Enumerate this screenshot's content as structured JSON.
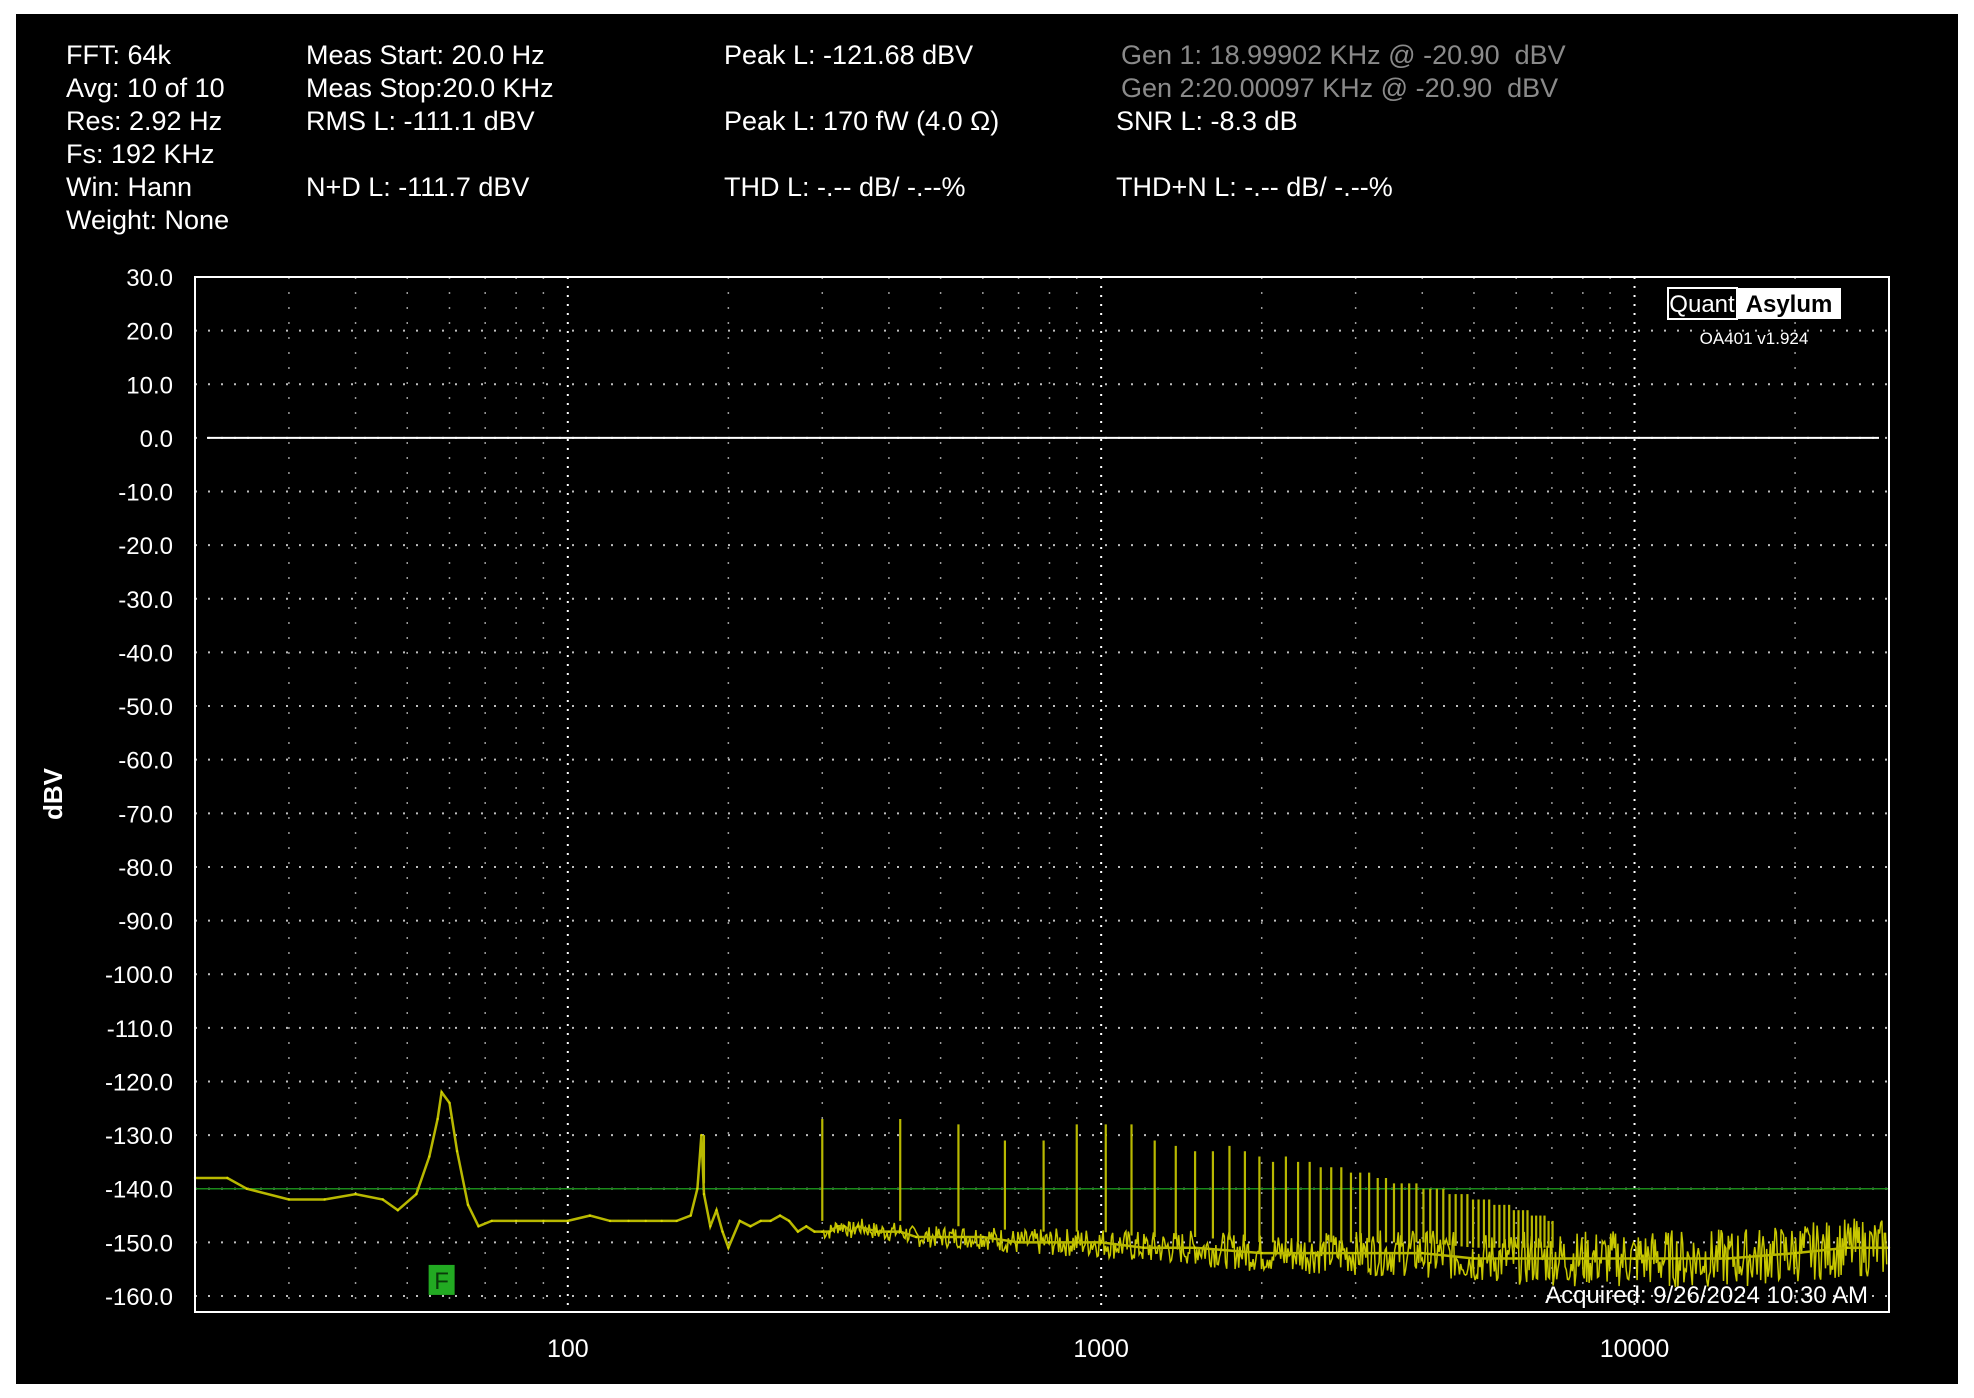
{
  "stats": {
    "fft": "FFT: 64k",
    "avg": "Avg: 10 of 10",
    "res": "Res: 2.92 Hz",
    "fs": "Fs: 192 KHz",
    "win": "Win: Hann",
    "weight": "Weight: None",
    "meas_start": "Meas Start: 20.0 Hz",
    "meas_stop": "Meas Stop:20.0 KHz",
    "rms": "RMS L: -111.1 dBV",
    "nd": "N+D L: -111.7 dBV",
    "peak_dbv": "Peak L: -121.68 dBV",
    "peak_power": "Peak L: 170 fW (4.0 Ω)",
    "thd": "THD L: -.-- dB/ -.--%",
    "gen1": "Gen 1: 18.99902 KHz @ -20.90  dBV",
    "gen2": "Gen 2:20.00097 KHz @ -20.90  dBV",
    "snr": "SNR L: -8.3 dB",
    "thdn": "THD+N L: -.-- dB/ -.--%"
  },
  "logo": {
    "left": "Quant",
    "right": "Asylum",
    "version": "OA401 v1.924"
  },
  "marker": {
    "label": "F",
    "x_hz": 58,
    "y_dbv": -157
  },
  "acquired": "Acquired: 9/26/2024  10:30 AM",
  "colors": {
    "background": "#000000",
    "trace": "#ffff00",
    "reference": "#ffffff",
    "threshold": "#1a8a1a",
    "marker": "#22aa22"
  },
  "chart_data": {
    "type": "line",
    "ylabel": "dBV",
    "xlabel": "",
    "x_scale": "log",
    "xlim": [
      20,
      30000
    ],
    "ylim": [
      -160,
      30
    ],
    "y_ticks": [
      "30.0",
      "20.0",
      "10.0",
      "0.0",
      "-10.0",
      "-20.0",
      "-30.0",
      "-40.0",
      "-50.0",
      "-60.0",
      "-70.0",
      "-80.0",
      "-90.0",
      "-100.0",
      "-110.0",
      "-120.0",
      "-130.0",
      "-140.0",
      "-150.0",
      "-160.0"
    ],
    "x_ticks": [
      "100",
      "1000",
      "10000"
    ],
    "grid": true,
    "series": [
      {
        "x": [
          20,
          23,
          25,
          30,
          35,
          40,
          45,
          48,
          52,
          55,
          57,
          58,
          60,
          62,
          65,
          68,
          72,
          80,
          90,
          100,
          110,
          120,
          130,
          140,
          150,
          160,
          170,
          175,
          178,
          180,
          185,
          190,
          195,
          200,
          210,
          220,
          230,
          240,
          250,
          260,
          270,
          280,
          290,
          300,
          310,
          320,
          330,
          340,
          350,
          380,
          400,
          420,
          450,
          500,
          550,
          600,
          700,
          800,
          900,
          1000,
          1200,
          1500,
          2000,
          2500,
          3000,
          4000,
          5000,
          6000,
          8000,
          10000,
          12000,
          15000,
          20000,
          25000,
          30000
        ],
        "y": [
          -138,
          -138,
          -140,
          -142,
          -142,
          -141,
          -142,
          -144,
          -141,
          -134,
          -127,
          -122,
          -124,
          -133,
          -143,
          -147,
          -146,
          -146,
          -146,
          -146,
          -145,
          -146,
          -146,
          -146,
          -146,
          -146,
          -145,
          -140,
          -130,
          -141,
          -147,
          -144,
          -148,
          -151,
          -146,
          -147,
          -146,
          -146,
          -145,
          -146,
          -148,
          -147,
          -148,
          -148,
          -148,
          -147,
          -147,
          -148,
          -147,
          -148,
          -148,
          -148,
          -149,
          -149,
          -149,
          -149,
          -150,
          -150,
          -150,
          -150,
          -151,
          -151,
          -152,
          -152,
          -152,
          -152,
          -153,
          -153,
          -153,
          -153,
          -153,
          -153,
          -152,
          -151,
          -151
        ]
      },
      {
        "name": "",
        "type": "harmonics",
        "x": [
          180,
          300,
          420,
          540,
          660,
          780,
          900,
          1020,
          1140,
          1260,
          1380,
          1500,
          1620,
          1740,
          1860,
          1980,
          2100,
          2220,
          2340,
          2460,
          2580,
          2700,
          2820,
          2940,
          3060,
          3180,
          3300,
          3420,
          3540,
          3660,
          3780,
          3900,
          4020,
          4140,
          4260,
          4380,
          4500,
          4620,
          4740,
          4860,
          4980,
          5100,
          5220,
          5340,
          5460,
          5580,
          5700,
          5820,
          5940,
          6060,
          6180,
          6300,
          6420,
          6540,
          6660,
          6780,
          6900,
          7020
        ],
        "y": [
          -130,
          -127,
          -127,
          -128,
          -131,
          -131,
          -128,
          -128,
          -128,
          -131,
          -132,
          -133,
          -133,
          -132,
          -133,
          -134,
          -135,
          -134,
          -135,
          -135,
          -136,
          -136,
          -136,
          -137,
          -137,
          -137,
          -138,
          -138,
          -139,
          -139,
          -139,
          -139,
          -140,
          -140,
          -140,
          -140,
          -141,
          -141,
          -141,
          -141,
          -142,
          -142,
          -142,
          -142,
          -143,
          -143,
          -143,
          -143,
          -144,
          -144,
          -144,
          -144,
          -145,
          -145,
          -145,
          -145,
          -146,
          -146
        ]
      }
    ],
    "reference_lines": [
      {
        "y": 0
      },
      {
        "y": -140
      }
    ]
  }
}
